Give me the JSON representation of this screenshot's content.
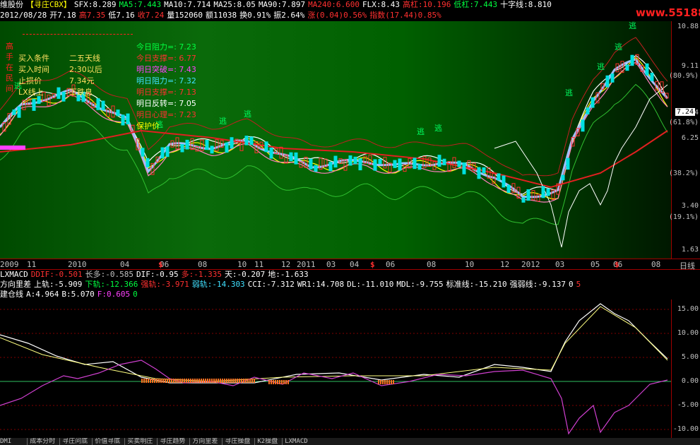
{
  "header": {
    "stock_name": "维股份",
    "stock_tag": "【寻庄CBX】",
    "items": [
      {
        "label": "SFX:8.289",
        "color": "wht"
      },
      {
        "label": "MA5:7.443",
        "color": "grn"
      },
      {
        "label": "MA10:7.714",
        "color": "wht"
      },
      {
        "label": "MA25:8.05",
        "color": "wht"
      },
      {
        "label": "MA90:7.897",
        "color": "wht"
      },
      {
        "label": "MA240:6.600",
        "color": "red"
      },
      {
        "label": "FLX:8.43",
        "color": "wht"
      },
      {
        "label": "高杠:10.196",
        "color": "red"
      },
      {
        "label": "低杠:7.443",
        "color": "grn"
      },
      {
        "label": "十字线:8.810",
        "color": "wht"
      }
    ],
    "logo": "www.55188.com"
  },
  "quote": {
    "date": "2012/08/28",
    "items": [
      {
        "label": "开7.18",
        "color": "wht"
      },
      {
        "label": "高7.35",
        "color": "red"
      },
      {
        "label": "低7.16",
        "color": "wht"
      },
      {
        "label": "收7.24",
        "color": "red"
      },
      {
        "label": "量152060",
        "color": "wht"
      },
      {
        "label": "额11038",
        "color": "wht"
      },
      {
        "label": "换0.91%",
        "color": "wht"
      },
      {
        "label": "振2.64%",
        "color": "wht"
      },
      {
        "label": "涨(0.04)0.56%",
        "color": "red"
      },
      {
        "label": "指数(17.44)0.85%",
        "color": "red"
      }
    ]
  },
  "panel": {
    "left_vertical": "高手在民间",
    "left_items": [
      {
        "label": "买入条件",
        "value": "二五天线"
      },
      {
        "label": "买入时间",
        "value": "2:30以后"
      },
      {
        "label": "止损价",
        "value": "7.34元"
      },
      {
        "label": "LX线上",
        "value": "下跌息"
      }
    ],
    "right_items": [
      {
        "label": "今日阻力=: 7.23",
        "color": "#00ff40"
      },
      {
        "label": "今日支撑=: 6.77",
        "color": "#ff3030"
      },
      {
        "label": "明日突破=: 7.43",
        "color": "#ff40ff"
      },
      {
        "label": "明日阻力=: 7.32",
        "color": "#40e0ff"
      },
      {
        "label": "明日支撑=: 7.13",
        "color": "#ff3030"
      },
      {
        "label": "明日反转=: 7.05",
        "color": "#ffffff"
      },
      {
        "label": "明日心理=: 7.23",
        "color": "#ff3030"
      },
      {
        "label": "保护价",
        "color": "#ffff00"
      }
    ],
    "escape_marks": "逃"
  },
  "right_axis": [
    {
      "label": "10.88"
    },
    {
      "label": "9.11"
    },
    {
      "label": "(80.9%)"
    },
    {
      "label": "7.24"
    },
    {
      "label": "(61.8%)"
    },
    {
      "label": "6.25"
    },
    {
      "label": "(38.2%)"
    },
    {
      "label": "3.40"
    },
    {
      "label": "(19.1%)"
    },
    {
      "label": "1.63"
    }
  ],
  "price_tag": "7.24",
  "date_axis": [
    "2009",
    "11",
    "2010",
    "04",
    "06",
    "08",
    "10",
    "11",
    "12",
    "2011",
    "03",
    "04",
    "06",
    "08",
    "10",
    "12",
    "2012",
    "03",
    "05",
    "06",
    "08"
  ],
  "date_axis_unit": "日线",
  "dollar_mark": "$",
  "macd": [
    {
      "label": "LXMACD",
      "color": "wht"
    },
    {
      "label": "DDIF:-0.501",
      "color": "red"
    },
    {
      "label": "长多:-0.585",
      "color": "gry"
    },
    {
      "label": "DIF:-0.95",
      "color": "wht"
    },
    {
      "label": "多:-1.335",
      "color": "red"
    },
    {
      "label": "天:-0.207",
      "color": "wht"
    },
    {
      "label": "地:-1.633",
      "color": "wht"
    }
  ],
  "indicator": [
    {
      "label": "方向里差",
      "color": "wht"
    },
    {
      "label": "上轨:-5.909",
      "color": "wht"
    },
    {
      "label": "下轨:-12.366",
      "color": "grn"
    },
    {
      "label": "强轨:-3.971",
      "color": "red"
    },
    {
      "label": "弱轨:-14.303",
      "color": "cyn"
    },
    {
      "label": "CCI:-7.312",
      "color": "wht"
    },
    {
      "label": "WR1:14.708",
      "color": "wht"
    },
    {
      "label": "DL:-11.010",
      "color": "wht"
    },
    {
      "label": "MDL:-9.755",
      "color": "wht"
    },
    {
      "label": "标准线:-15.210",
      "color": "wht"
    },
    {
      "label": "强弱线:-9.137",
      "color": "wht"
    },
    {
      "label": "0",
      "color": "wht"
    },
    {
      "label": "5",
      "color": "red"
    }
  ],
  "cang": [
    {
      "label": "建仓线",
      "color": "wht"
    },
    {
      "label": "A:4.964",
      "color": "wht"
    },
    {
      "label": "B:5.070",
      "color": "wht"
    },
    {
      "label": "F:0.605",
      "color": "mag"
    },
    {
      "label": "0",
      "color": "grn"
    }
  ],
  "lower_axis": [
    {
      "label": "15.00"
    },
    {
      "label": "10.00"
    },
    {
      "label": "5.00"
    },
    {
      "label": "0.00"
    },
    {
      "label": "-5.00"
    },
    {
      "label": "-10.00"
    }
  ],
  "tabs": [
    "成本分时",
    "寻庄问底",
    "价值寻底",
    "买卖明庄",
    "寻庄趋势",
    "方向里差",
    "寻庄操盘",
    "K2操盘",
    "LXMACD"
  ],
  "tab_prefix": "DMI"
}
